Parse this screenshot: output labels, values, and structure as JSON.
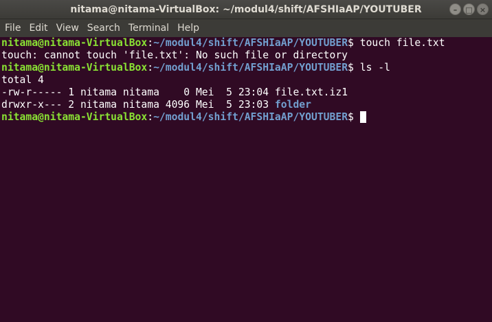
{
  "window": {
    "title": "nitama@nitama-VirtualBox: ~/modul4/shift/AFSHIaAP/YOUTUBER",
    "controls": {
      "minimize_glyph": "–",
      "maximize_glyph": "□",
      "close_glyph": "×"
    }
  },
  "menubar": {
    "items": [
      {
        "label": "File"
      },
      {
        "label": "Edit"
      },
      {
        "label": "View"
      },
      {
        "label": "Search"
      },
      {
        "label": "Terminal"
      },
      {
        "label": "Help"
      }
    ]
  },
  "terminal": {
    "colors": {
      "background": "#300a24",
      "prompt_user": "#8ae234",
      "prompt_path": "#729fcf",
      "text": "#ffffff"
    },
    "lines": [
      {
        "type": "prompt",
        "user": "nitama@nitama-VirtualBox",
        "sep": ":",
        "path": "~/modul4/shift/AFSHIaAP/YOUTUBER",
        "symbol": "$ ",
        "command": "touch file.txt"
      },
      {
        "type": "output",
        "text": "touch: cannot touch 'file.txt': No such file or directory"
      },
      {
        "type": "prompt",
        "user": "nitama@nitama-VirtualBox",
        "sep": ":",
        "path": "~/modul4/shift/AFSHIaAP/YOUTUBER",
        "symbol": "$ ",
        "command": "ls -l"
      },
      {
        "type": "output",
        "text": "total 4"
      },
      {
        "type": "listing",
        "meta": "-rw-r----- 1 nitama nitama    0 Mei  5 23:04 ",
        "name": "file.txt.iz1",
        "is_dir": false
      },
      {
        "type": "listing",
        "meta": "drwxr-x--- 2 nitama nitama 4096 Mei  5 23:03 ",
        "name": "folder",
        "is_dir": true
      },
      {
        "type": "prompt",
        "user": "nitama@nitama-VirtualBox",
        "sep": ":",
        "path": "~/modul4/shift/AFSHIaAP/YOUTUBER",
        "symbol": "$ ",
        "command": ""
      }
    ]
  }
}
